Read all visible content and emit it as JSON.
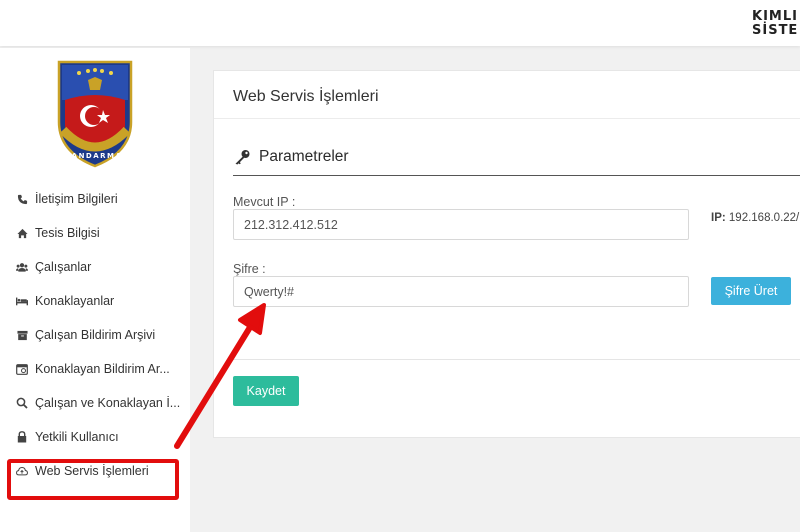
{
  "header": {
    "brand_line1": "KİMLİ",
    "brand_line2": "SİSTE"
  },
  "sidebar": {
    "emblem_text": "JANDARMA",
    "items": [
      {
        "label": "İletişim Bilgileri",
        "icon": "phone-icon"
      },
      {
        "label": "Tesis Bilgisi",
        "icon": "home-icon"
      },
      {
        "label": "Çalışanlar",
        "icon": "users-icon"
      },
      {
        "label": "Konaklayanlar",
        "icon": "bed-icon"
      },
      {
        "label": "Çalışan Bildirim Arşivi",
        "icon": "archive-icon"
      },
      {
        "label": "Konaklayan Bildirim Ar...",
        "icon": "calendar-icon"
      },
      {
        "label": "Çalışan ve Konaklayan İ...",
        "icon": "search-icon"
      },
      {
        "label": "Yetkili Kullanıcı",
        "icon": "lock-icon"
      },
      {
        "label": "Web Servis İşlemleri",
        "icon": "cloud-icon"
      }
    ]
  },
  "main": {
    "title": "Web Servis İşlemleri",
    "section_title": "Parametreler",
    "current_ip_label": "Mevcut IP :",
    "current_ip_value": "212.312.412.512",
    "ip_note_label": "IP:",
    "ip_note_value": "192.168.0.22/",
    "password_label": "Şifre :",
    "password_value": "Qwerty!#",
    "generate_button": "Şifre Üret",
    "save_button": "Kaydet"
  },
  "colors": {
    "highlight": "#e20d0d",
    "primary_button": "#3cb1dc",
    "save_button": "#2dbc9c"
  }
}
